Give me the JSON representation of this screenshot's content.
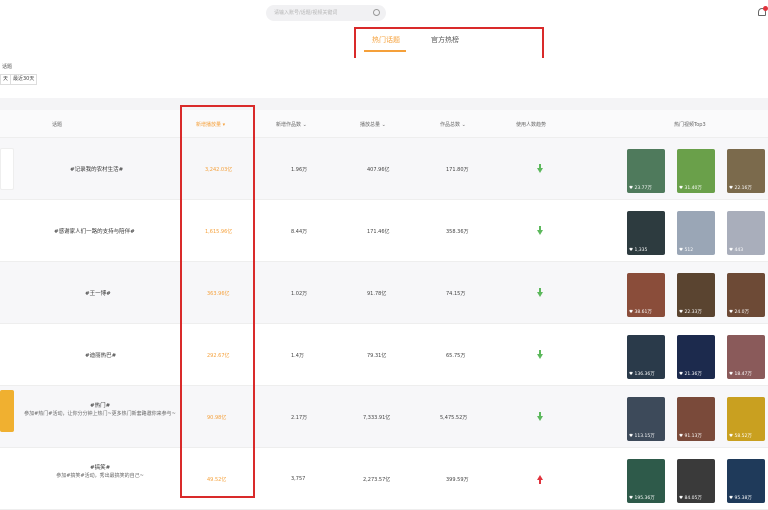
{
  "search": {
    "placeholder": "请输入账号/话题/视频关键词"
  },
  "tabs": [
    {
      "label": "热门话题",
      "active": true
    },
    {
      "label": "官方热榜",
      "active": false
    }
  ],
  "filter": {
    "label": "话题",
    "chips": [
      "天",
      "最近30天"
    ]
  },
  "table": {
    "headers": {
      "topic": "话题",
      "new_plays": "新增播放量",
      "new_works": "新增作品数",
      "plays_total": "播放总量",
      "works_total": "作品总数",
      "users_trend": "使用人数趋势",
      "hot_videos": "热门视频Top3"
    },
    "rows": [
      {
        "title": "#记录我的农村生活#",
        "desc": "",
        "new_plays": "3,242.03亿",
        "new_works": "1.96万",
        "plays_total": "407.96亿",
        "works_total": "171.80万",
        "trend": "down",
        "videos": [
          {
            "likes": "23.77万",
            "color": "#4f7a5c"
          },
          {
            "likes": "31.40万",
            "color": "#6aa04a"
          },
          {
            "likes": "22.16万",
            "color": "#7b6a4c"
          }
        ]
      },
      {
        "title": "#感谢家人们一路的支持与陪伴#",
        "desc": "",
        "new_plays": "1,615.96亿",
        "new_works": "8.44万",
        "plays_total": "171.46亿",
        "works_total": "358.36万",
        "trend": "down",
        "videos": [
          {
            "likes": "1,335",
            "color": "#2d3b3f"
          },
          {
            "likes": "512",
            "color": "#9aa6b6"
          },
          {
            "likes": "443",
            "color": "#a9aebb"
          }
        ]
      },
      {
        "title": "#王一博#",
        "desc": "",
        "new_plays": "363.96亿",
        "new_works": "1.02万",
        "plays_total": "91.78亿",
        "works_total": "74.15万",
        "trend": "down",
        "videos": [
          {
            "likes": "38.61万",
            "color": "#8a4d3a"
          },
          {
            "likes": "22.33万",
            "color": "#5a4430"
          },
          {
            "likes": "24.0万",
            "color": "#6d4a36"
          }
        ]
      },
      {
        "title": "#迪丽热巴#",
        "desc": "",
        "new_plays": "292.67亿",
        "new_works": "1.4万",
        "plays_total": "79.31亿",
        "works_total": "65.75万",
        "trend": "down",
        "videos": [
          {
            "likes": "136.36万",
            "color": "#2a3a4a"
          },
          {
            "likes": "21.36万",
            "color": "#1c2a4d"
          },
          {
            "likes": "18.47万",
            "color": "#8a5a5a"
          }
        ]
      },
      {
        "title": "#热门#",
        "desc": "参加#热门#活动，让你分分钟上热门~更多热门新套路邀你来参与~",
        "new_plays": "90.98亿",
        "new_works": "2.17万",
        "plays_total": "7,333.91亿",
        "works_total": "5,475.52万",
        "trend": "down",
        "videos": [
          {
            "likes": "113.15万",
            "color": "#3d4a5a"
          },
          {
            "likes": "91.13万",
            "color": "#7a4a3a"
          },
          {
            "likes": "58.52万",
            "color": "#c9a020"
          }
        ]
      },
      {
        "title": "#搞笑#",
        "desc": "参加#搞笑#活动，秀出最搞笑的自己~",
        "new_plays": "49.52亿",
        "new_works": "3,757",
        "plays_total": "2,273.57亿",
        "works_total": "399.59万",
        "trend": "up",
        "videos": [
          {
            "likes": "195.36万",
            "color": "#2e5a4a"
          },
          {
            "likes": "84.05万",
            "color": "#3a3a3a"
          },
          {
            "likes": "95.38万",
            "color": "#1f3a5a"
          }
        ]
      }
    ]
  },
  "colors": {
    "accent": "#f5a03a",
    "highlight_box": "#d92a2a",
    "trend_down": "#5cb85c",
    "trend_up": "#e0323c"
  }
}
